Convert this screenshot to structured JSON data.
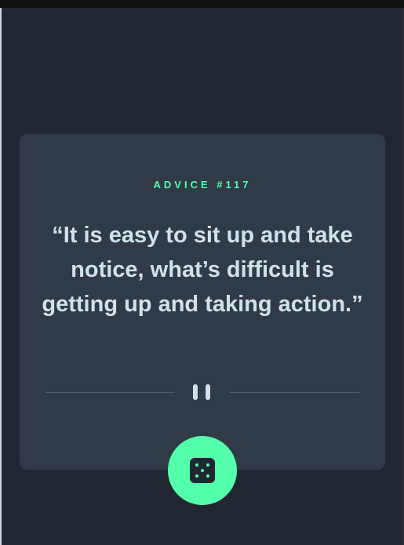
{
  "advice": {
    "label": "ADVICE #117",
    "quote": "“It is easy to sit up and take notice, what’s difficult is getting up and taking action.”"
  },
  "divider": {
    "icon": "pause-icon"
  },
  "dice_button": {
    "icon": "dice-icon"
  },
  "colors": {
    "background": "#202733",
    "card": "#313a48",
    "accent": "#53ffab",
    "text": "#cee3e9",
    "divider": "#4f5d74"
  }
}
